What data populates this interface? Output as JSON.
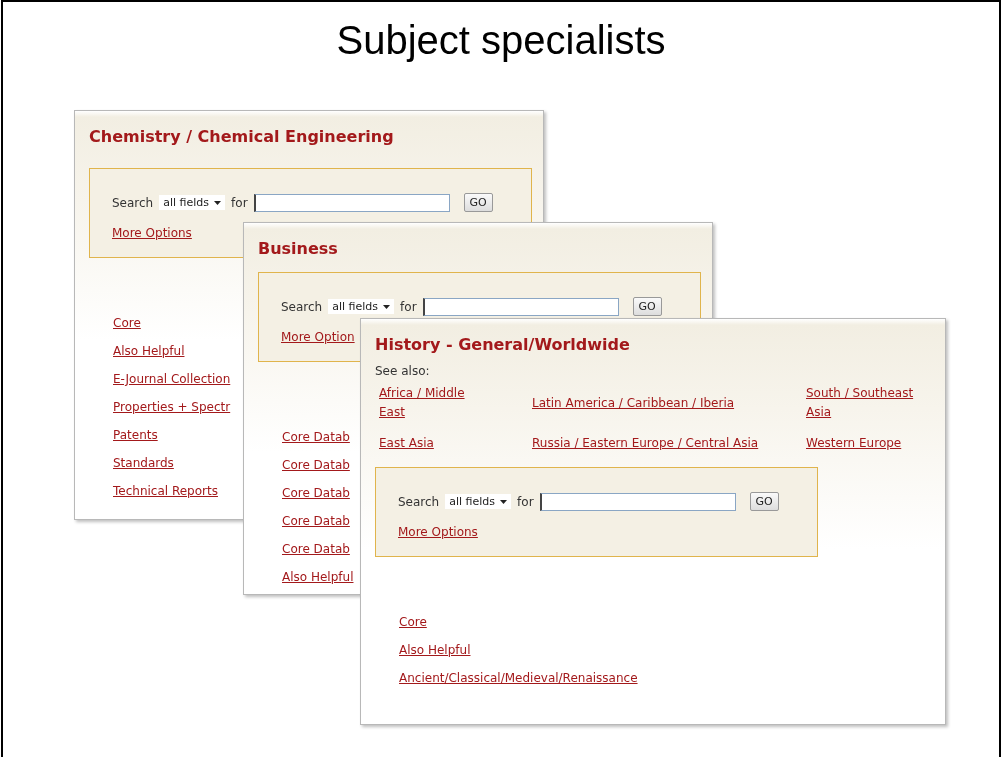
{
  "slide": {
    "title": "Subject specialists"
  },
  "panels": [
    {
      "title": "Chemistry / Chemical Engineering",
      "search": {
        "label": "Search",
        "scope": "all fields",
        "connector": "for",
        "button": "GO",
        "more_options": "More Options"
      },
      "links": [
        "Core",
        "Also Helpful",
        "E-Journal Collection",
        "Properties + Spectr",
        "Patents",
        "Standards",
        "Technical Reports"
      ]
    },
    {
      "title": "Business",
      "search": {
        "label": "Search",
        "scope": "all fields",
        "connector": "for",
        "button": "GO",
        "more_options": "More Option"
      },
      "links": [
        "Core Datab",
        "Core Datab",
        "Core Datab",
        "Core Datab",
        "Core Datab",
        "Also Helpful"
      ]
    },
    {
      "title": "History - General/Worldwide",
      "see_also_label": "See also:",
      "see_also": [
        "Africa / Middle East",
        "Latin America / Caribbean / Iberia",
        "South / Southeast Asia",
        "East Asia",
        "Russia / Eastern Europe / Central Asia",
        "Western Europe"
      ],
      "search": {
        "label": "Search",
        "scope": "all fields",
        "connector": "for",
        "button": "GO",
        "more_options": "More Options"
      },
      "links": [
        "Core",
        "Also Helpful",
        "Ancient/Classical/Medieval/Renaissance"
      ]
    }
  ]
}
